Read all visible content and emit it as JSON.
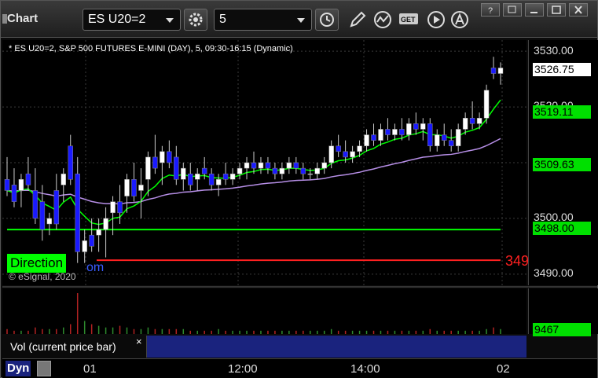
{
  "window": {
    "title": "Chart"
  },
  "toolbar": {
    "symbol_value": "ES U20=2",
    "interval_value": "5",
    "get_label": "GET"
  },
  "chart": {
    "info_line": "* ES U20=2, S&P 500 FUTURES E-MINI (DAY), 5, 09:30-16:15 (Dynamic)",
    "copyright": "© eSignal, 2020",
    "direction_label": "Direction",
    "direction_suffix": "om",
    "red_line_label": "349",
    "price_ticks": [
      "3530.00",
      "3520.00",
      "3500.00",
      "3490.00"
    ],
    "badges": {
      "last": "3526.75",
      "ma_fast": "3519.11",
      "ma_mid": "3509.63",
      "level": "3498.00"
    },
    "volume_badge": "9467",
    "legend": "Vol (current price bar)",
    "legend_close": "×",
    "time_labels": [
      "01",
      "12:00",
      "14:00",
      "02"
    ],
    "dyn_label": "Dyn",
    "colors": {
      "up": "#ffffff",
      "down": "#1a1aff",
      "ma_fast": "#00ff00",
      "ma_slow": "#b68ee6",
      "vwap_red": "#ff2020",
      "level": "#00ff00"
    }
  },
  "chart_data": {
    "type": "candlestick",
    "ylim": [
      3488,
      3532
    ],
    "candles": [
      [
        3507,
        3511,
        3504,
        3505
      ],
      [
        3506,
        3509,
        3502,
        3503
      ],
      [
        3505,
        3508,
        3502,
        3507
      ],
      [
        3508,
        3511,
        3505,
        3506
      ],
      [
        3505,
        3509,
        3499,
        3500
      ],
      [
        3503,
        3506,
        3496,
        3498
      ],
      [
        3499,
        3501,
        3497,
        3500
      ],
      [
        3505,
        3508,
        3498,
        3499
      ],
      [
        3506,
        3509,
        3503,
        3508
      ],
      [
        3513,
        3515,
        3506,
        3507
      ],
      [
        3508,
        3511,
        3492,
        3494
      ],
      [
        3494,
        3498,
        3492,
        3496
      ],
      [
        3497,
        3500,
        3494,
        3495
      ],
      [
        3497,
        3500,
        3494,
        3498
      ],
      [
        3498,
        3502,
        3493,
        3500
      ],
      [
        3501,
        3504,
        3497,
        3503
      ],
      [
        3503,
        3506,
        3499,
        3501
      ],
      [
        3504,
        3508,
        3501,
        3507
      ],
      [
        3507,
        3510,
        3503,
        3504
      ],
      [
        3505,
        3509,
        3500,
        3506
      ],
      [
        3507,
        3512,
        3504,
        3511
      ],
      [
        3511,
        3515,
        3508,
        3509
      ],
      [
        3510,
        3513,
        3506,
        3512
      ],
      [
        3512,
        3514,
        3509,
        3510
      ],
      [
        3511,
        3513,
        3506,
        3507
      ],
      [
        3507,
        3510,
        3505,
        3509
      ],
      [
        3508,
        3510,
        3505,
        3506
      ],
      [
        3507,
        3509,
        3505,
        3508
      ],
      [
        3509,
        3511,
        3507,
        3508
      ],
      [
        3508,
        3509,
        3505,
        3506
      ],
      [
        3506,
        3508,
        3504,
        3507
      ],
      [
        3508,
        3510,
        3506,
        3507
      ],
      [
        3507,
        3509,
        3506,
        3508
      ],
      [
        3508,
        3510,
        3507,
        3509
      ],
      [
        3509,
        3511,
        3507,
        3510
      ],
      [
        3510,
        3512,
        3508,
        3509
      ],
      [
        3509,
        3511,
        3508,
        3510
      ],
      [
        3510,
        3511,
        3508,
        3509
      ],
      [
        3509,
        3510,
        3507,
        3508
      ],
      [
        3508,
        3510,
        3507,
        3509
      ],
      [
        3509,
        3511,
        3508,
        3510
      ],
      [
        3510,
        3511,
        3508,
        3509
      ],
      [
        3509,
        3510,
        3507,
        3508
      ],
      [
        3508,
        3509,
        3507,
        3508
      ],
      [
        3508,
        3510,
        3507,
        3509
      ],
      [
        3509,
        3511,
        3508,
        3510
      ],
      [
        3510,
        3514,
        3509,
        3513
      ],
      [
        3513,
        3515,
        3511,
        3512
      ],
      [
        3512,
        3514,
        3510,
        3511
      ],
      [
        3511,
        3513,
        3510,
        3512
      ],
      [
        3512,
        3514,
        3511,
        3513
      ],
      [
        3513,
        3516,
        3512,
        3515
      ],
      [
        3515,
        3517,
        3513,
        3514
      ],
      [
        3514,
        3517,
        3513,
        3516
      ],
      [
        3516,
        3518,
        3514,
        3515
      ],
      [
        3515,
        3517,
        3514,
        3516
      ],
      [
        3516,
        3518,
        3514,
        3515
      ],
      [
        3515,
        3518,
        3514,
        3517
      ],
      [
        3517,
        3519,
        3515,
        3516
      ],
      [
        3516,
        3518,
        3514,
        3517
      ],
      [
        3517,
        3518,
        3512,
        3513
      ],
      [
        3513,
        3516,
        3512,
        3515
      ],
      [
        3515,
        3517,
        3513,
        3514
      ],
      [
        3514,
        3516,
        3512,
        3513
      ],
      [
        3513,
        3517,
        3512,
        3516
      ],
      [
        3516,
        3519,
        3515,
        3518
      ],
      [
        3518,
        3521,
        3516,
        3517
      ],
      [
        3517,
        3519,
        3516,
        3518
      ],
      [
        3518,
        3524,
        3517,
        3523
      ],
      [
        3527,
        3529,
        3525,
        3526
      ],
      [
        3526,
        3528,
        3524,
        3527
      ]
    ],
    "volume": [
      3,
      2,
      2,
      2,
      4,
      3,
      3,
      3,
      4,
      6,
      25,
      8,
      6,
      5,
      4,
      4,
      5,
      4,
      3,
      3,
      4,
      3,
      3,
      3,
      3,
      3,
      2,
      2,
      2,
      2,
      3,
      2,
      2,
      2,
      2,
      2,
      2,
      2,
      2,
      2,
      2,
      2,
      2,
      2,
      2,
      2,
      3,
      2,
      2,
      2,
      2,
      2,
      2,
      2,
      2,
      2,
      2,
      2,
      2,
      2,
      3,
      2,
      2,
      2,
      2,
      2,
      2,
      2,
      3,
      4,
      3
    ]
  }
}
